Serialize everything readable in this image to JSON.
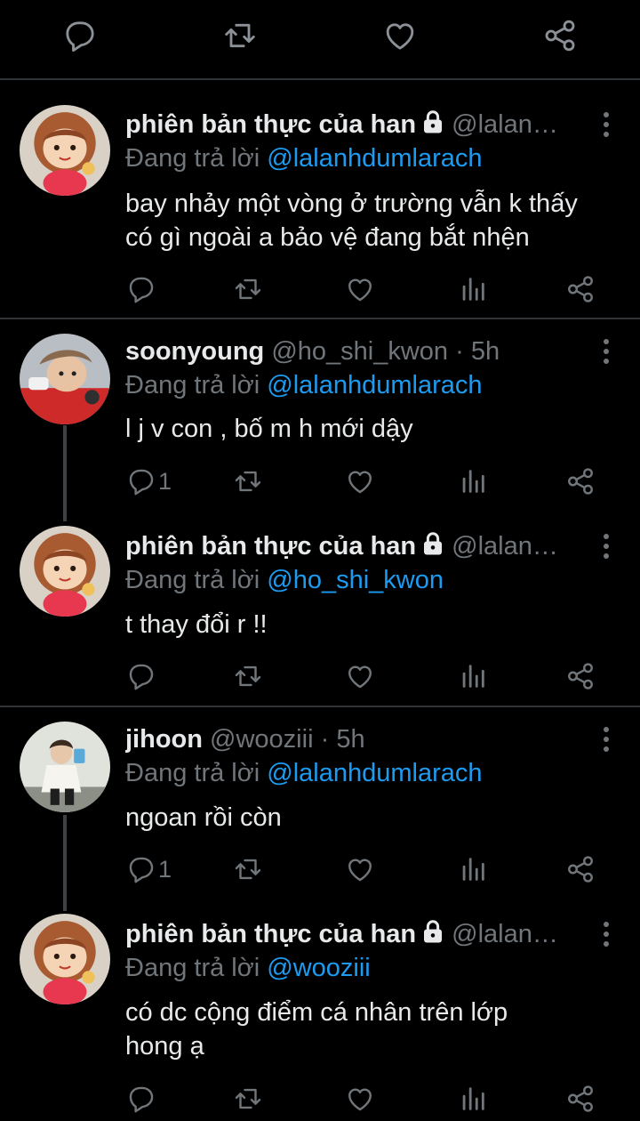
{
  "colors": {
    "background": "#000000",
    "name": "#e7e9ea",
    "muted": "#71767b",
    "link": "#1d9bf0",
    "divider": "#2f3336"
  },
  "top_actions": [
    "reply-icon",
    "retweet-icon",
    "like-icon",
    "share-icon"
  ],
  "tweets": [
    {
      "name": "phiên bản thực của han",
      "handle": "@lalan…",
      "time": "",
      "locked": true,
      "replying_label": "Đang trả lời",
      "replying_to": "@lalanhdumlarach",
      "text_lines": [
        "bay nhảy một vòng ở trường vẫn k thấy",
        "có gì ngoài a bảo vệ đang bắt nhện"
      ],
      "reply_count": "",
      "avatar": "cartoon-girl-avatar"
    },
    {
      "name": "soonyoung",
      "handle": "@ho_shi_kwon",
      "time": "5h",
      "locked": false,
      "replying_label": "Đang trả lời",
      "replying_to": "@lalanhdumlarach",
      "text_lines": [
        "l j v con , bố m h mới dậy"
      ],
      "reply_count": "1",
      "avatar": "soonyoung-photo-avatar"
    },
    {
      "name": "phiên bản thực của han",
      "handle": "@lalan…",
      "time": "",
      "locked": true,
      "replying_label": "Đang trả lời",
      "replying_to": "@ho_shi_kwon",
      "text_lines": [
        "t thay đổi r !!"
      ],
      "reply_count": "",
      "avatar": "cartoon-girl-avatar"
    },
    {
      "name": "jihoon",
      "handle": "@wooziii",
      "time": "5h",
      "locked": false,
      "replying_label": "Đang trả lời",
      "replying_to": "@lalanhdumlarach",
      "text_lines": [
        "ngoan rồi còn"
      ],
      "reply_count": "1",
      "avatar": "jihoon-photo-avatar"
    },
    {
      "name": "phiên bản thực của han",
      "handle": "@lalan…",
      "time": "",
      "locked": true,
      "replying_label": "Đang trả lời",
      "replying_to": "@wooziii",
      "text_lines": [
        "có dc cộng điểm cá nhân trên lớp",
        "hong ạ"
      ],
      "reply_count": "",
      "avatar": "cartoon-girl-avatar"
    }
  ],
  "time_separator": "·"
}
